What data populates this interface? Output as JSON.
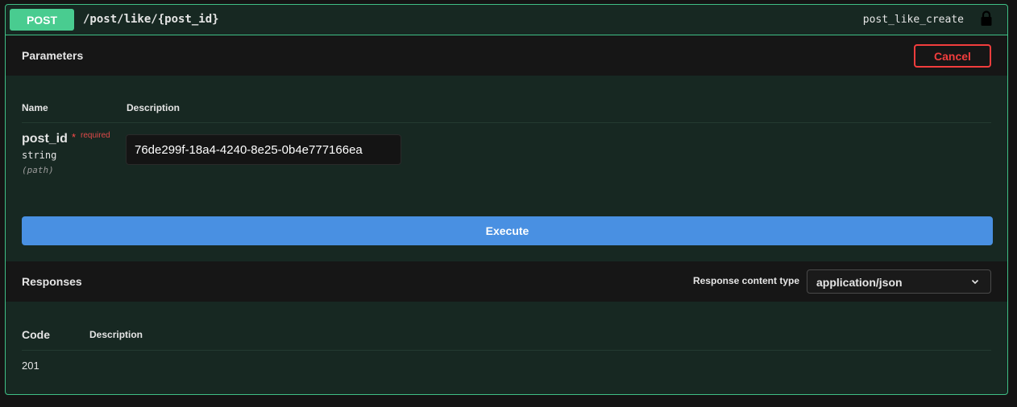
{
  "operation": {
    "method": "POST",
    "path": "/post/like/{post_id}",
    "operation_id": "post_like_create"
  },
  "parameters": {
    "title": "Parameters",
    "cancel_label": "Cancel",
    "col_name": "Name",
    "col_description": "Description",
    "param": {
      "name": "post_id",
      "required_star": "*",
      "required_label": "required",
      "type": "string",
      "in": "(path)",
      "value": "76de299f-18a4-4240-8e25-0b4e777166ea"
    }
  },
  "execute_label": "Execute",
  "responses": {
    "title": "Responses",
    "content_type_label": "Response content type",
    "content_type_value": "application/json",
    "col_code": "Code",
    "col_description": "Description",
    "rows": [
      {
        "code": "201"
      }
    ]
  },
  "icons": {
    "lock": "lock-icon",
    "chevron": "chevron-down-icon"
  },
  "colors": {
    "method_post": "#49cc90",
    "border": "#3fbf86",
    "cancel": "#f23d3d",
    "execute": "#4990e2",
    "required": "#e04a4a"
  }
}
